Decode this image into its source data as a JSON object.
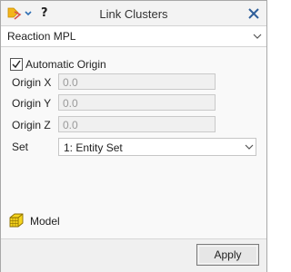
{
  "header": {
    "title": "Link Clusters",
    "help_label": "?",
    "menu_icon": "tool-menu-icon",
    "close_icon": "close-icon"
  },
  "type_selector": {
    "value": "Reaction MPL"
  },
  "automatic_origin": {
    "label": "Automatic Origin",
    "checked": true
  },
  "origin": {
    "x": {
      "label": "Origin X",
      "value": "0.0"
    },
    "y": {
      "label": "Origin Y",
      "value": "0.0"
    },
    "z": {
      "label": "Origin Z",
      "value": "0.0"
    }
  },
  "set": {
    "label": "Set",
    "value": "1: Entity Set"
  },
  "model": {
    "label": "Model",
    "icon": "model-cube-icon"
  },
  "footer": {
    "apply_label": "Apply"
  },
  "colors": {
    "accent": "#f3b51b",
    "icon_blue": "#2f6fb4",
    "field_disabled_bg": "#f0f0f0"
  }
}
